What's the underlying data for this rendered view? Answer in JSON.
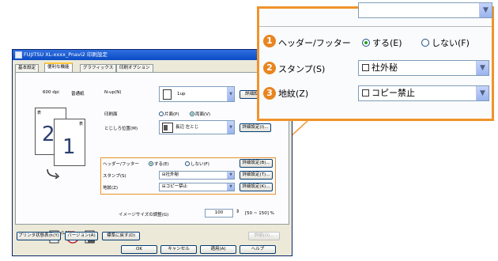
{
  "dialog": {
    "title": "FUJITSU XL-xxxx_Pnavi2 印刷設定",
    "tabs": [
      "基本設定",
      "便利な機能",
      "グラフィックス",
      "印刷オプション"
    ],
    "active_tab_index": 1,
    "preview": {
      "dpi": "600 dpi",
      "quality": "普通紙",
      "page_numbers": [
        "2",
        "1"
      ],
      "sheet_labels": [
        "表",
        "表"
      ],
      "paper_size": "A4 (LEF)"
    },
    "nup": {
      "label": "N-up(N)",
      "value": "1up",
      "detail_button": "詳細設定"
    },
    "duplex": {
      "label": "印刷面",
      "options": [
        "片面(P)",
        "両面(V)"
      ],
      "selected_index": 1
    },
    "binding": {
      "label": "とじしろ位置(M)",
      "value": "長辺 左とじ",
      "detail_button": "詳細設定(I)..."
    },
    "header_footer": {
      "label": "ヘッダー/フッター",
      "options": [
        "する(E)",
        "しない(F)"
      ],
      "selected_index": 0,
      "detail_button": "詳細設定(B)..."
    },
    "stamp": {
      "label": "スタンプ(S)",
      "value": "社外秘",
      "detail_button": "詳細設定(T)..."
    },
    "watermark": {
      "label": "地紋(Z)",
      "value": "コピー禁止",
      "detail_button": "詳細設定(K)..."
    },
    "image_size": {
      "label": "イメージサイズの調整(G)",
      "value": "100",
      "range": "[50 ~ 150] %"
    },
    "bottom_buttons": [
      "プリンタ状態表示(Y)",
      "バージョン(A)",
      "標準に戻す(D)"
    ],
    "disabled_button": "詳細(O)...",
    "footer_buttons": [
      "OK",
      "キャンセル",
      "適用(A)",
      "ヘルプ"
    ]
  },
  "zoom": {
    "header_footer": {
      "number": "1",
      "label": "ヘッダー/フッター",
      "options": [
        "する(E)",
        "しない(F)"
      ],
      "selected_index": 0
    },
    "stamp": {
      "number": "2",
      "label": "スタンプ(S)",
      "value": "社外秘"
    },
    "watermark": {
      "number": "3",
      "label": "地紋(Z)",
      "value": "コピー禁止"
    }
  },
  "colors": {
    "callout_orange": "#f0932b",
    "number_badge": "#e8851f",
    "titlebar_blue": "#0a4bc4",
    "dialog_face": "#ece9d8"
  }
}
